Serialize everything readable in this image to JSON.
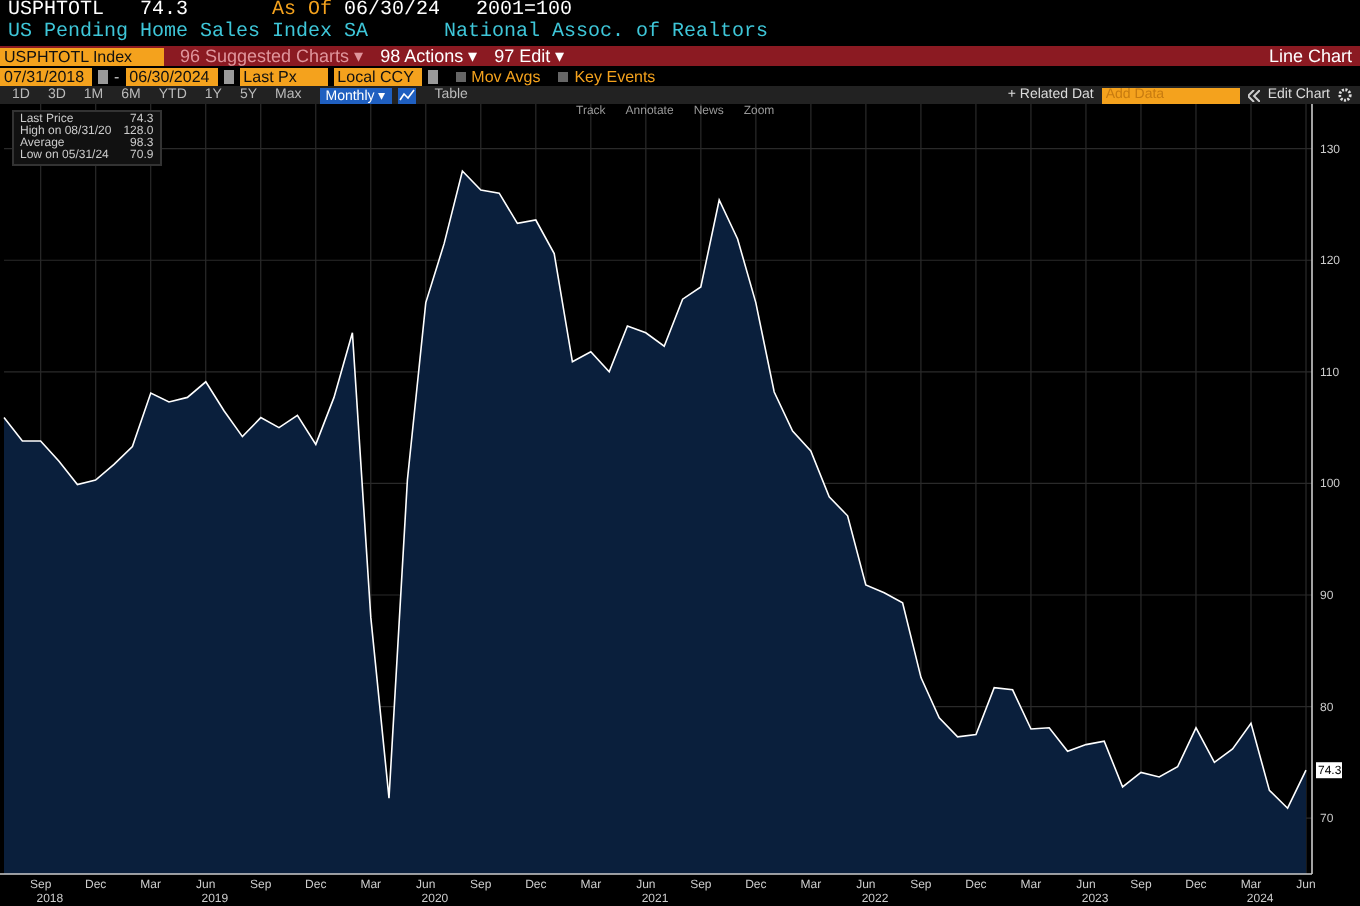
{
  "header": {
    "ticker": "USPHTOTL",
    "last": "74.3",
    "as_of_label": "As Of",
    "as_of_date": "06/30/24",
    "base": "2001=100",
    "name": "US Pending Home Sales Index SA",
    "source": "National Assoc. of Realtors"
  },
  "command_bar": {
    "security": "USPHTOTL Index",
    "menus": [
      {
        "label": "96 Suggested Charts ▾",
        "disabled": true
      },
      {
        "label": "98 Actions ▾",
        "disabled": false
      },
      {
        "label": "97 Edit ▾",
        "disabled": false
      }
    ],
    "view": "Line Chart"
  },
  "range_bar": {
    "start": "07/31/2018",
    "dash": "-",
    "end": "06/30/2024",
    "field": "Last Px",
    "currency": "Local CCY",
    "toggles": [
      {
        "label": "Mov Avgs",
        "checked": false
      },
      {
        "label": "Key Events",
        "checked": false
      }
    ]
  },
  "period_bar": {
    "periods": [
      {
        "label": "1D",
        "selected": false
      },
      {
        "label": "3D",
        "selected": false
      },
      {
        "label": "1M",
        "selected": false
      },
      {
        "label": "6M",
        "selected": false
      },
      {
        "label": "YTD",
        "selected": false
      },
      {
        "label": "1Y",
        "selected": false
      },
      {
        "label": "5Y",
        "selected": false
      },
      {
        "label": "Max",
        "selected": false
      }
    ],
    "frequency": "Monthly ▾",
    "table": "Table",
    "related": "+ Related Dat",
    "add_data_placeholder": "Add Data",
    "edit_chart": "Edit Chart"
  },
  "chart_tools": [
    "Track",
    "Annotate",
    "News",
    "Zoom"
  ],
  "legend": [
    {
      "value": "74.3"
    },
    {
      "label": "High on 08/31/20",
      "value": "128.0"
    },
    {
      "label": "Average",
      "value": "98.3"
    },
    {
      "label": "Low on 05/31/24",
      "value": "70.9"
    }
  ],
  "last_price_tag": "74.3",
  "year_labels": [
    "2018",
    "2019",
    "2020",
    "2021",
    "2022",
    "2023",
    "2024"
  ],
  "chart": {
    "chart_data": {
      "type": "area",
      "grid": true,
      "ylim": [
        65,
        134
      ],
      "categories": [
        null,
        null,
        "Sep",
        null,
        null,
        "Dec",
        null,
        null,
        "Mar",
        null,
        null,
        "Jun",
        null,
        null,
        "Sep",
        null,
        null,
        "Dec",
        null,
        null,
        "Mar",
        null,
        null,
        "Jun",
        null,
        null,
        "Sep",
        null,
        null,
        "Dec",
        null,
        null,
        "Mar",
        null,
        null,
        "Jun",
        null,
        null,
        "Sep",
        null,
        null,
        "Dec",
        null,
        null,
        "Mar",
        null,
        null,
        "Jun",
        null,
        null,
        "Sep",
        null,
        null,
        "Dec",
        null,
        null,
        "Mar",
        null,
        null,
        "Jun",
        null,
        null,
        "Sep",
        null,
        null,
        "Dec",
        null,
        null,
        "Mar",
        null,
        null,
        "Jun"
      ],
      "yticks": [
        70,
        80,
        90,
        100,
        110,
        120,
        130
      ],
      "series": [
        {
          "name": "Last Price",
          "color": "#ffffff",
          "values": [
            105.9,
            103.8,
            103.8,
            102.0,
            99.9,
            100.3,
            101.7,
            103.3,
            108.1,
            107.3,
            107.7,
            109.1,
            106.5,
            104.2,
            105.9,
            105.0,
            106.1,
            103.5,
            107.7,
            113.5,
            88.0,
            71.8,
            100.3,
            116.2,
            121.5,
            128.0,
            126.3,
            126.0,
            123.3,
            123.6,
            120.6,
            110.9,
            111.8,
            110.0,
            114.1,
            113.5,
            112.3,
            116.5,
            117.6,
            125.4,
            121.9,
            116.2,
            108.2,
            104.7,
            102.9,
            98.8,
            97.1,
            90.9,
            90.2,
            89.3,
            82.6,
            79.0,
            77.3,
            77.5,
            81.7,
            81.5,
            78.0,
            78.1,
            76.0,
            76.6,
            76.9,
            72.8,
            74.1,
            73.7,
            74.6,
            78.1,
            75.0,
            76.2,
            78.5,
            72.5,
            70.9,
            74.3
          ]
        }
      ]
    }
  }
}
